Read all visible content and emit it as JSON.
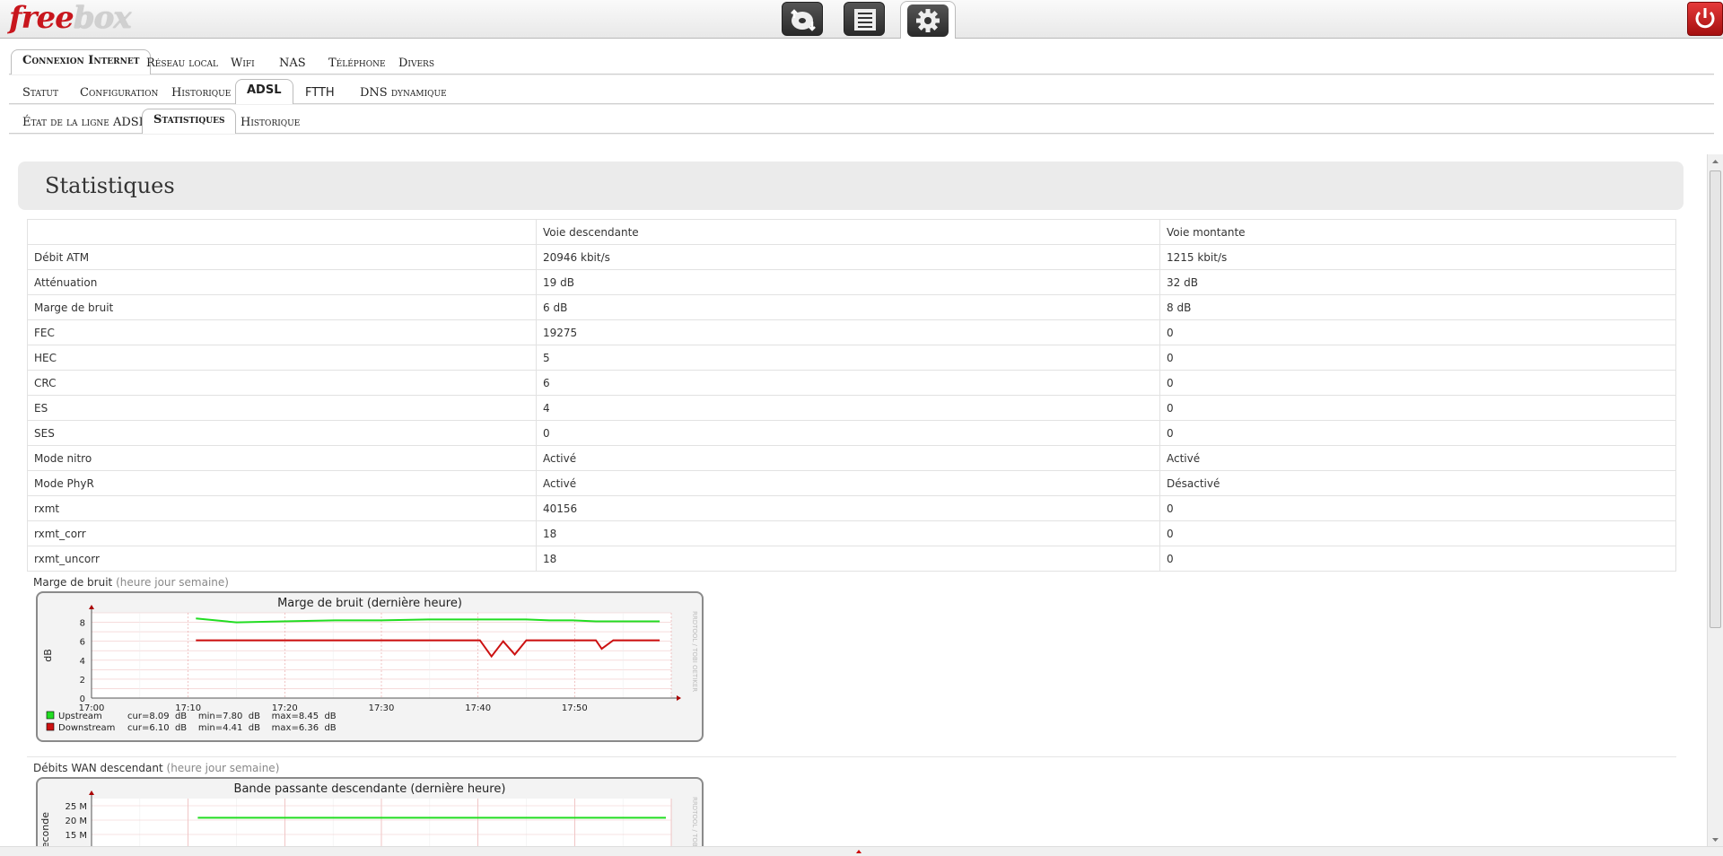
{
  "app": {
    "logo_free": "free",
    "logo_box": "box"
  },
  "topnav": {
    "icons": [
      "download-icon",
      "list-icon",
      "settings-icon"
    ],
    "power_icon": "power-icon"
  },
  "tabs_main": [
    "Connexion Internet",
    "Réseau local",
    "Wifi",
    "NAS",
    "Téléphone",
    "Divers"
  ],
  "tabs_sub": [
    "Statut",
    "Configuration",
    "Historique",
    "ADSL",
    "FTTH",
    "DNS dynamique"
  ],
  "tabs_sub2": [
    "État de la ligne ADSL",
    "Statistiques",
    "Historique"
  ],
  "page": {
    "title": "Statistiques"
  },
  "table": {
    "headers": [
      "",
      "Voie descendante",
      "Voie montante"
    ],
    "rows": [
      [
        "Débit ATM",
        "20946 kbit/s",
        "1215 kbit/s"
      ],
      [
        "Atténuation",
        "19 dB",
        "32 dB"
      ],
      [
        "Marge de bruit",
        "6 dB",
        "8 dB"
      ],
      [
        "FEC",
        "19275",
        "0"
      ],
      [
        "HEC",
        "5",
        "0"
      ],
      [
        "CRC",
        "6",
        "0"
      ],
      [
        "ES",
        "4",
        "0"
      ],
      [
        "SES",
        "0",
        "0"
      ],
      [
        "Mode nitro",
        "Activé",
        "Activé"
      ],
      [
        "Mode PhyR",
        "Activé",
        "Désactivé"
      ],
      [
        "rxmt",
        "40156",
        "0"
      ],
      [
        "rxmt_corr",
        "18",
        "0"
      ],
      [
        "rxmt_uncorr",
        "18",
        "0"
      ]
    ]
  },
  "graph1": {
    "label": "Marge de bruit",
    "links": "(heure jour semaine)",
    "title": "Marge de bruit (dernière heure)",
    "ylabel": "dB",
    "watermark": "RRDTOOL / TOBI OETIKER",
    "legend": [
      {
        "name": "Upstream",
        "stats": "cur=8.09  dB    min=7.80  dB    max=8.45  dB",
        "color": "#22dd22"
      },
      {
        "name": "Downstream",
        "stats": "cur=6.10  dB    min=4.41  dB    max=6.36  dB",
        "color": "#cc1111"
      }
    ]
  },
  "graph2": {
    "label": "Débits WAN descendant",
    "links": "(heure jour semaine)",
    "title": "Bande passante descendante (dernière heure)",
    "ylabel": "seconde",
    "watermark": "RRDTOOL / TOBI OETIKER"
  },
  "chart_data": [
    {
      "type": "line",
      "title": "Marge de bruit (dernière heure)",
      "ylabel": "dB",
      "xlabel": "",
      "ylim": [
        0,
        9
      ],
      "x_ticks": [
        "17:00",
        "17:10",
        "17:20",
        "17:30",
        "17:40",
        "17:50"
      ],
      "y_ticks": [
        0,
        2,
        4,
        6,
        8
      ],
      "x": [
        17.18,
        17.25,
        17.33,
        17.42,
        17.5,
        17.58,
        17.67,
        17.69,
        17.71,
        17.73,
        17.75,
        17.79,
        17.83,
        17.87,
        17.88,
        17.9,
        17.95,
        17.98
      ],
      "series": [
        {
          "name": "Upstream",
          "values": [
            8.4,
            8.0,
            8.1,
            8.2,
            8.2,
            8.3,
            8.3,
            8.3,
            8.3,
            8.3,
            8.3,
            8.2,
            8.2,
            8.1,
            8.1,
            8.1,
            8.1,
            8.1
          ]
        },
        {
          "name": "Downstream",
          "values": [
            6.1,
            6.1,
            6.1,
            6.1,
            6.1,
            6.1,
            6.1,
            4.4,
            6.0,
            4.6,
            6.1,
            6.1,
            6.1,
            6.1,
            5.2,
            6.1,
            6.1,
            6.1
          ]
        }
      ],
      "grid": true
    },
    {
      "type": "line",
      "title": "Bande passante descendante (dernière heure)",
      "ylabel": "seconde",
      "y_ticks": [
        "15 M",
        "20 M",
        "25 M"
      ],
      "series": [
        {
          "values": [
            20.8,
            20.8,
            20.8,
            20.8,
            20.8
          ]
        }
      ],
      "grid": true
    }
  ]
}
